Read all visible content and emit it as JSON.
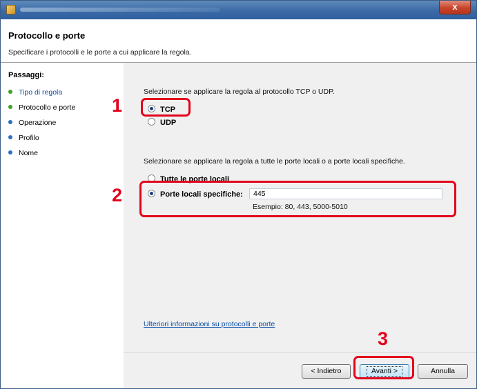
{
  "window": {
    "close_glyph": "x",
    "title_text": ""
  },
  "header": {
    "title": "Protocollo e porte",
    "subtitle": "Specificare i protocolli e le porte a cui applicare la regola."
  },
  "steps": {
    "title": "Passaggi:",
    "items": [
      "Tipo di regola",
      "Protocollo e porte",
      "Operazione",
      "Profilo",
      "Nome"
    ],
    "active_index": 0
  },
  "protocol": {
    "prompt": "Selezionare se applicare la regola al protocollo TCP o UDP.",
    "options": [
      "TCP",
      "UDP"
    ],
    "selected": "TCP"
  },
  "ports": {
    "prompt": "Selezionare se applicare la regola a tutte le porte locali o a porte locali specifiche.",
    "all_label": "Tutte le porte locali",
    "specific_label": "Porte locali specifiche:",
    "value": "445",
    "example": "Esempio: 80, 443, 5000-5010",
    "selected": "specific"
  },
  "link_text": "Ulteriori informazioni su protocolli e porte",
  "buttons": {
    "back": "< Indietro",
    "next": "Avanti >",
    "cancel": "Annulla"
  },
  "callouts": [
    "1",
    "2",
    "3"
  ],
  "colors": {
    "callout": "#e3001b",
    "title_bar": "#3b6aa6",
    "link": "#0b4fa8"
  }
}
